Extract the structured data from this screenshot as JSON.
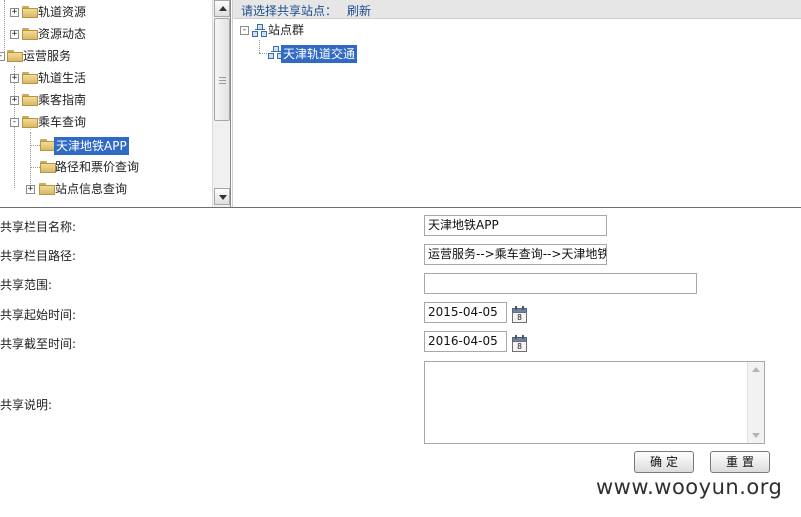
{
  "tree": {
    "items": [
      {
        "label": "轨道资源",
        "toggle": "+"
      },
      {
        "label": "资源动态",
        "toggle": "+"
      },
      {
        "label": "运营服务",
        "toggle": "-"
      },
      {
        "label": "轨道生活",
        "toggle": "+"
      },
      {
        "label": "乘客指南",
        "toggle": "+"
      },
      {
        "label": "乘车查询",
        "toggle": "-"
      },
      {
        "label": "天津地铁APP",
        "selected": true
      },
      {
        "label": "路径和票价查询"
      },
      {
        "label": "站点信息查询",
        "toggle": "+"
      }
    ]
  },
  "sites": {
    "header_label": "请选择共享站点：",
    "refresh": "刷新",
    "group_toggle": "-",
    "group": "站点群",
    "site": "天津轨道交通"
  },
  "form": {
    "name_label": "共享栏目名称:",
    "name_value": "天津地铁APP",
    "path_label": "共享栏目路径:",
    "path_value": "运营服务-->乘车查询-->天津地铁APP",
    "scope_label": "共享范围:",
    "scope_value": "",
    "start_label": "共享起始时间:",
    "start_value": "2015-04-05",
    "end_label": "共享截至时间:",
    "end_value": "2016-04-05",
    "calendar_day": "8",
    "desc_label": "共享说明:",
    "desc_value": "",
    "confirm": "确定",
    "reset": "重置"
  },
  "watermark": "www.wooyun.org",
  "colors": {
    "header_text": "#1d4e8f",
    "selection": "#316ac5",
    "folder": "#e8c877"
  },
  "icons": [
    "folder-icon",
    "network-icon",
    "calendar-icon",
    "scroll-up-arrow",
    "scroll-down-arrow"
  ]
}
